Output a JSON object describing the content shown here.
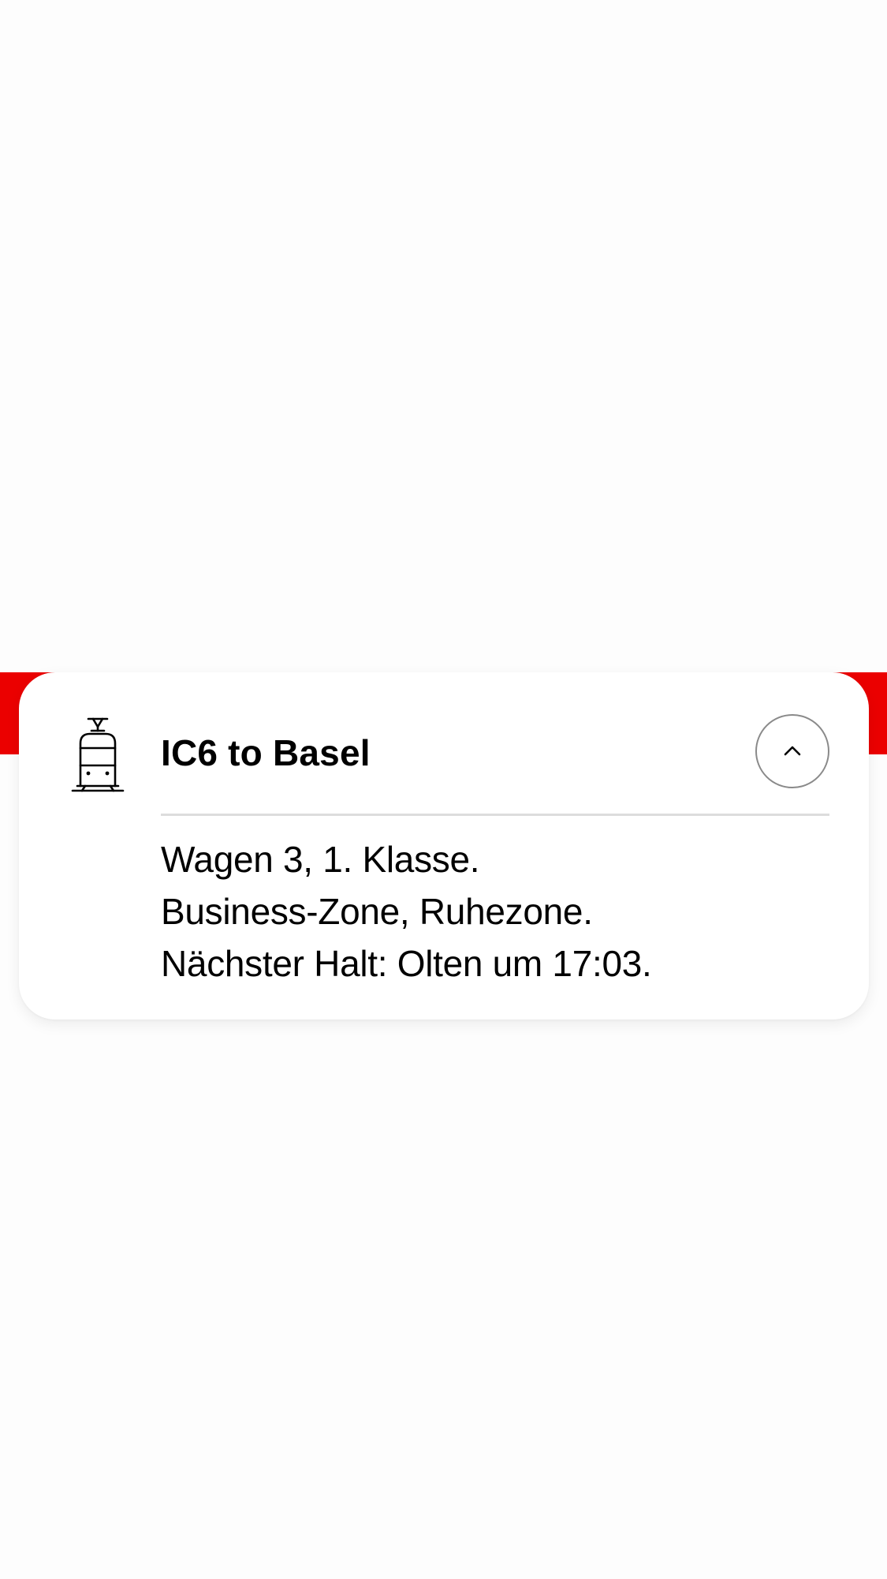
{
  "colors": {
    "accent_red": "#eb0000",
    "card_background": "#ffffff",
    "page_background": "#fdfdfd",
    "text": "#000000",
    "divider": "#dcdcdc",
    "button_border": "#8a8a8a"
  },
  "card": {
    "icon": "train-icon",
    "title": "IC6 to Basel",
    "collapse_button_icon": "chevron-up-icon",
    "details": [
      "Wagen 3, 1. Klasse.",
      "Business-Zone, Ruhezone.",
      "Nächster Halt: Olten um 17:03."
    ]
  }
}
